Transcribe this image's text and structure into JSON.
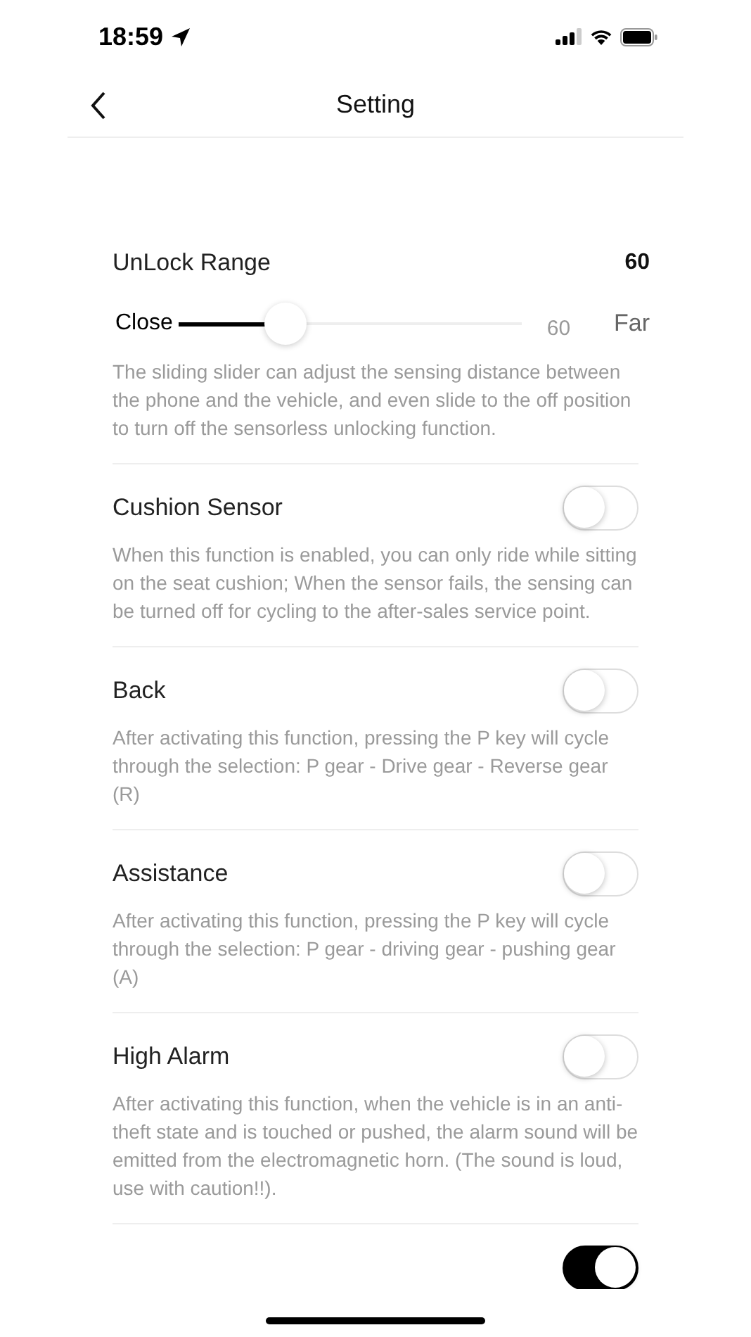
{
  "status_bar": {
    "time": "18:59"
  },
  "nav": {
    "title": "Setting"
  },
  "unlock_range": {
    "title": "UnLock Range",
    "value": "60",
    "min_label": "Close",
    "reading": "60",
    "max_label": "Far",
    "level": 0.31,
    "description": "The sliding slider can adjust the sensing distance between the phone and the vehicle, and even slide to the off position to turn off the sensorless unlocking function."
  },
  "settings": [
    {
      "title": "Cushion Sensor",
      "on": false,
      "description": "When this function is enabled, you can only ride while sitting on the seat cushion; When the sensor fails, the sensing can be turned off for cycling to the after-sales service point."
    },
    {
      "title": "Back",
      "on": false,
      "description": "After activating this function, pressing the P key will cycle through the selection: P gear - Drive gear - Reverse gear (R)"
    },
    {
      "title": "Assistance",
      "on": false,
      "description": "After activating this function, pressing the P key will cycle through the selection: P gear - driving gear - pushing gear (A)"
    },
    {
      "title": "High Alarm",
      "on": false,
      "description": "After activating this function, when the vehicle is in an anti-theft state and is touched or pushed, the alarm sound will be emitted from the electromagnetic horn. (The sound is loud, use with caution!!)."
    },
    {
      "on": true
    }
  ]
}
